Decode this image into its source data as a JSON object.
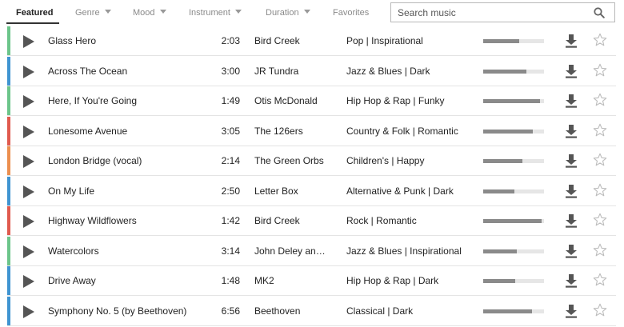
{
  "tabs": {
    "featured": "Featured",
    "genre": "Genre",
    "mood": "Mood",
    "instrument": "Instrument",
    "duration": "Duration",
    "favorites": "Favorites"
  },
  "search": {
    "placeholder": "Search music",
    "value": ""
  },
  "genre_colors": {
    "green": "#6cc58a",
    "blue": "#3f94d1",
    "red": "#e05a4e",
    "orange": "#ec8f4f"
  },
  "tracks": [
    {
      "title": "Glass Hero",
      "duration": "2:03",
      "artist": "Bird Creek",
      "genre": "Pop | Inspirational",
      "color": "#6cc58a",
      "level": 0.59
    },
    {
      "title": "Across The Ocean",
      "duration": "3:00",
      "artist": "JR Tundra",
      "genre": "Jazz & Blues | Dark",
      "color": "#3f94d1",
      "level": 0.71
    },
    {
      "title": "Here, If You're Going",
      "duration": "1:49",
      "artist": "Otis McDonald",
      "genre": "Hip Hop & Rap | Funky",
      "color": "#6cc58a",
      "level": 0.93
    },
    {
      "title": "Lonesome Avenue",
      "duration": "3:05",
      "artist": "The 126ers",
      "genre": "Country & Folk | Romantic",
      "color": "#e05a4e",
      "level": 0.82
    },
    {
      "title": "London Bridge (vocal)",
      "duration": "2:14",
      "artist": "The Green Orbs",
      "genre": "Children's | Happy",
      "color": "#ec8f4f",
      "level": 0.64
    },
    {
      "title": "On My Life",
      "duration": "2:50",
      "artist": "Letter Box",
      "genre": "Alternative & Punk | Dark",
      "color": "#3f94d1",
      "level": 0.51
    },
    {
      "title": "Highway Wildflowers",
      "duration": "1:42",
      "artist": "Bird Creek",
      "genre": "Rock | Romantic",
      "color": "#e05a4e",
      "level": 0.96
    },
    {
      "title": "Watercolors",
      "duration": "3:14",
      "artist": "John Deley an…",
      "genre": "Jazz & Blues | Inspirational",
      "color": "#6cc58a",
      "level": 0.55
    },
    {
      "title": "Drive Away",
      "duration": "1:48",
      "artist": "MK2",
      "genre": "Hip Hop & Rap | Dark",
      "color": "#3f94d1",
      "level": 0.53
    },
    {
      "title": "Symphony No. 5 (by Beethoven)",
      "duration": "6:56",
      "artist": "Beethoven",
      "genre": "Classical | Dark",
      "color": "#3f94d1",
      "level": 0.8
    }
  ],
  "icons": {
    "play": "play-icon",
    "download": "download-icon",
    "favorite": "star-outline-icon",
    "search": "search-icon"
  }
}
